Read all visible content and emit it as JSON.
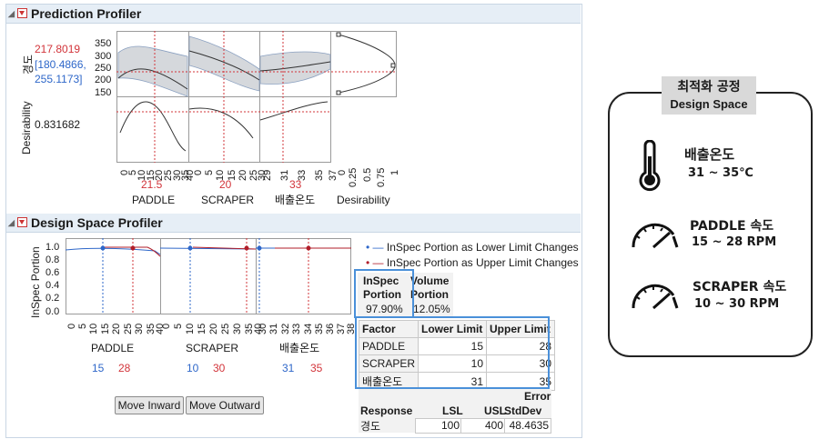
{
  "prediction_profiler": {
    "title": "Prediction Profiler",
    "response_label": "경도",
    "predicted_value": "217.8019",
    "ci_text": "[180.4866, 255.1173]",
    "desirability_label": "Desirability",
    "desirability_value": "0.831682",
    "y_ticks": [
      "350",
      "300",
      "250",
      "200",
      "150"
    ],
    "factors": [
      {
        "name": "PADDLE",
        "current": "21.5",
        "ticks": [
          "0",
          "5",
          "10",
          "15",
          "20",
          "25",
          "30",
          "35",
          "40"
        ]
      },
      {
        "name": "SCRAPER",
        "current": "20",
        "ticks": [
          "0",
          "5",
          "10",
          "15",
          "20",
          "25",
          "30"
        ]
      },
      {
        "name": "배출온도",
        "current": "33",
        "ticks": [
          "29",
          "31",
          "33",
          "35",
          "37"
        ]
      }
    ],
    "desirability_axis": {
      "name": "Desirability",
      "ticks": [
        "0",
        "0.25",
        "0.5",
        "0.75",
        "1"
      ]
    }
  },
  "design_space_profiler": {
    "title": "Design Space Profiler",
    "y_label": "InSpec Portion",
    "y_ticks": [
      "1.0",
      "0.8",
      "0.6",
      "0.4",
      "0.2",
      "0.0"
    ],
    "legend": [
      {
        "label": "InSpec Portion as Lower Limit Changes",
        "color": "#2e67c9"
      },
      {
        "label": "InSpec Portion as Upper Limit Changes",
        "color": "#b01e2a"
      }
    ],
    "factors": [
      {
        "name": "PADDLE",
        "lower": "15",
        "upper": "28",
        "ticks": [
          "0",
          "5",
          "10",
          "15",
          "20",
          "25",
          "30",
          "35",
          "40"
        ]
      },
      {
        "name": "SCRAPER",
        "lower": "10",
        "upper": "30",
        "ticks": [
          "0",
          "5",
          "10",
          "15",
          "20",
          "25",
          "30",
          "35",
          "40"
        ]
      },
      {
        "name": "배출온도",
        "lower": "31",
        "upper": "35",
        "ticks": [
          "30",
          "31",
          "32",
          "33",
          "34",
          "35",
          "36",
          "37",
          "38"
        ]
      }
    ],
    "inspec": {
      "header1": "InSpec",
      "header2": "Portion",
      "value": "97.90%"
    },
    "volume": {
      "header1": "Volume",
      "header2": "Portion",
      "value": "12.05%"
    },
    "factor_table": {
      "headers": [
        "Factor",
        "Lower Limit",
        "Upper Limit"
      ],
      "rows": [
        [
          "PADDLE",
          "15",
          "28"
        ],
        [
          "SCRAPER",
          "10",
          "30"
        ],
        [
          "배출온도",
          "31",
          "35"
        ]
      ]
    },
    "response_table": {
      "headers": [
        "Response",
        "LSL",
        "USL",
        "Error",
        "StdDev"
      ],
      "row": [
        "경도",
        "100",
        "400",
        "48.4635"
      ]
    },
    "buttons": {
      "inward": "Move Inward",
      "outward": "Move Outward"
    }
  },
  "design_space_card": {
    "title_line1": "최적화 공정",
    "title_line2": "Design Space",
    "items": [
      {
        "icon": "thermometer-icon",
        "label": "배출온도",
        "range": "31 ~ 35℃"
      },
      {
        "icon": "gauge-icon",
        "label": "PADDLE 속도",
        "range": "15 ~ 28 RPM"
      },
      {
        "icon": "gauge-icon",
        "label": "SCRAPER 속도",
        "range": "10 ~ 30 RPM"
      }
    ]
  }
}
